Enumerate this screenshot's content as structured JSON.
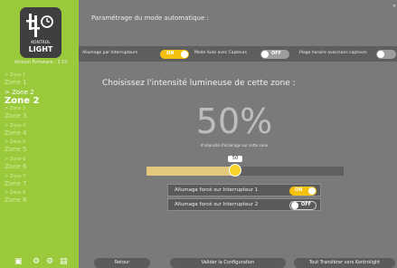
{
  "sidebar": {
    "brand_line1": "KONTROL",
    "brand_line2": "LIGHT",
    "firmware": "Version Firmware : 3.10",
    "zones": [
      {
        "sub": "> Zone 1",
        "name": "Zone 1"
      },
      {
        "sub": "> Zone 2",
        "name": "Zone 2"
      },
      {
        "sub": "> Zone 3",
        "name": "Zone 3"
      },
      {
        "sub": "> Zone 4",
        "name": "Zone 4"
      },
      {
        "sub": "> Zone 5",
        "name": "Zone 5"
      },
      {
        "sub": "> Zone 6",
        "name": "Zone 6"
      },
      {
        "sub": "> Zone 7",
        "name": "Zone 7"
      },
      {
        "sub": "> Zone 8",
        "name": "Zone 8"
      }
    ],
    "bottom_icons": [
      "wifi-icon",
      "settings-icon",
      "gear-icon",
      "info-icon"
    ]
  },
  "main": {
    "title": "Paramétrage du mode automatique :",
    "toggles": [
      {
        "label": "Allumage par Interrupteurs",
        "state": "ON"
      },
      {
        "label": "Mode Auto avec Capteurs",
        "state": "OFF"
      },
      {
        "label": "Plage horaire avec/sans capteurs",
        "state": "OFF"
      }
    ],
    "intensity_title": "Choisissez l'intensité lumineuse de cette zone :",
    "percent": "50%",
    "percent_caption": "d'intensité d'éclairage sur cette zone",
    "slider_value": "50",
    "slider_fraction": 0.45,
    "force": [
      {
        "label": "Allumage forcé sur Interrupteur 1",
        "state": "ON"
      },
      {
        "label": "Allumage forcé sur Interrupteur 2",
        "state": "OFF"
      }
    ]
  },
  "footer": {
    "back": "Retour",
    "validate": "Valider la Configuration",
    "transfer": "Tout Transférer vers Kontrolight"
  },
  "colors": {
    "sidebar": "#9ac93c",
    "background": "#7a7a7a",
    "accent": "#f4c10f",
    "slider_fill": "#e3c87e"
  }
}
